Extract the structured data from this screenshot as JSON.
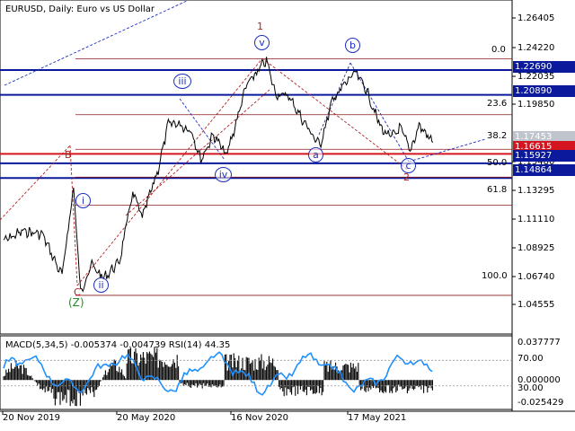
{
  "header": {
    "title": "EURUSD, Daily:  Euro vs US Dollar"
  },
  "macd_header": {
    "text": "MACD(5,34,5) -0.005374 -0.004739 RSI(14) 44.35"
  },
  "price_axis": {
    "ticks": [
      "1.26405",
      "1.24220",
      "1.22035",
      "1.19850",
      "1.17665",
      "1.15480",
      "1.13295",
      "1.11110",
      "1.08925",
      "1.06740",
      "1.04555"
    ]
  },
  "macd_axis": {
    "ticks": [
      "0.037777",
      "70.00",
      "0.000000",
      "30.00",
      "-0.025429"
    ]
  },
  "time_axis": {
    "labels": [
      "20 Nov 2019",
      "20 May 2020",
      "16 Nov 2020",
      "17 May 2021"
    ]
  },
  "price_labels": [
    {
      "value": "1.22690",
      "color": "#0b1a9c"
    },
    {
      "value": "1.20890",
      "color": "#0b1a9c"
    },
    {
      "value": "1.17453",
      "color": "#c0c4cc"
    },
    {
      "value": "1.16615",
      "color": "#d4141e"
    },
    {
      "value": "1.15927",
      "color": "#0b1a9c"
    },
    {
      "value": "1.14864",
      "color": "#0b1a9c"
    }
  ],
  "fib_levels": [
    "0.0",
    "23.6",
    "38.2",
    "50.0",
    "61.8",
    "100.0"
  ],
  "wave_labels": {
    "one": "1",
    "two": "2",
    "B": "B",
    "C": "C",
    "Z": "(Z)",
    "i": "i",
    "ii": "ii",
    "iii": "iii",
    "iv": "iv",
    "v": "v",
    "a": "a",
    "b": "b",
    "c": "c"
  },
  "colors": {
    "price_line": "#000000",
    "level_blue": "#0b1a9c",
    "level_red": "#d4141e",
    "fib": "#8b1a1a",
    "wave_blue": "#1c2fbf",
    "rsi": "#1e90ff",
    "histogram": "#000000"
  },
  "chart_data": {
    "type": "line",
    "title": "EURUSD, Daily:  Euro vs US Dollar",
    "x": [
      "2019-11-20",
      "2019-12-20",
      "2020-01-20",
      "2020-02-10",
      "2020-02-20",
      "2020-03-09",
      "2020-03-20",
      "2020-04-05",
      "2020-04-25",
      "2020-05-20",
      "2020-06-10",
      "2020-06-25",
      "2020-07-20",
      "2020-08-05",
      "2020-08-20",
      "2020-09-10",
      "2020-09-25",
      "2020-10-15",
      "2020-11-04",
      "2020-11-16",
      "2020-12-05",
      "2021-01-06",
      "2021-01-20",
      "2021-02-10",
      "2021-03-05",
      "2021-03-31",
      "2021-04-20",
      "2021-05-10",
      "2021-05-25",
      "2021-06-10",
      "2021-07-05",
      "2021-07-20",
      "2021-08-05",
      "2021-08-20",
      "2021-09-03",
      "2021-09-15",
      "2021-09-25"
    ],
    "series": [
      {
        "values": [
          1.103,
          1.11,
          1.108,
          1.087,
          1.078,
          1.142,
          1.065,
          1.086,
          1.076,
          1.088,
          1.138,
          1.12,
          1.155,
          1.188,
          1.188,
          1.183,
          1.162,
          1.18,
          1.165,
          1.183,
          1.215,
          1.234,
          1.21,
          1.208,
          1.19,
          1.172,
          1.205,
          1.217,
          1.225,
          1.215,
          1.185,
          1.178,
          1.185,
          1.168,
          1.187,
          1.18,
          1.1745
        ]
      }
    ],
    "ylim": [
      1.0356,
      1.275
    ],
    "levels": {
      "blue": [
        1.2269,
        1.2089,
        1.15927,
        1.14864
      ],
      "red": [
        1.16615
      ],
      "current": 1.17453
    },
    "fibonacci": {
      "high": 1.2349,
      "low": 1.0636,
      "ratios": [
        0.0,
        23.6,
        38.2,
        50.0,
        61.8,
        100.0
      ]
    },
    "indicator": {
      "name": "MACD(5,34,5) RSI(14)",
      "macd": -0.005374,
      "signal": -0.004739,
      "rsi": 44.35,
      "ylim": [
        -0.025429,
        0.037777
      ],
      "rsi_levels": [
        70,
        30
      ]
    }
  }
}
